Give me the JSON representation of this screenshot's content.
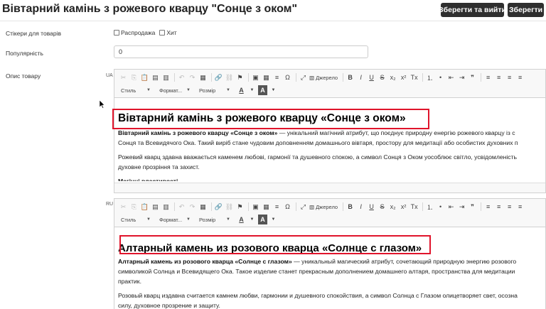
{
  "header": {
    "title": "Вівтарний камінь з рожевого кварцу \"Сонце з оком\"",
    "save_exit_label": "Зберегти та вийти",
    "save_label": "Зберегти"
  },
  "stickers": {
    "label": "Стікери для товарів",
    "options": [
      "Распродажа",
      "Хит"
    ]
  },
  "popularity": {
    "label": "Популярність",
    "value": "0"
  },
  "description": {
    "label": "Опис товару",
    "toolbar": {
      "source_label": "Джерело",
      "style_label": "Стиль",
      "format_label": "Формат...",
      "size_label": "Розмір"
    },
    "editors": [
      {
        "lang": "UA",
        "heading": "Вівтарний камінь з рожевого кварцу «Сонце з оком»",
        "p1_bold": "Вівтарний камінь з рожевого кварцу «Сонце з оком»",
        "p1_rest": " — унікальний магічний атрибут, що поєднує природну енергію рожевого кварцу із с",
        "p1_line2": "Сонця та Всевидячого Ока. Такий виріб стане чудовим доповненням домашнього вівтаря, простору для медитації або особистих духовних п",
        "p2_line1": "Рожевий кварц здавна вважається каменем любові, гармонії та душевного спокою, а символ Сонця з Оком уособлює світло, усвідомленість",
        "p2_line2": "духовне прозріння та захист.",
        "p3_partial": "Магічні властивості"
      },
      {
        "lang": "RU",
        "heading": "Алтарный камень из розового кварца «Солнце с глазом»",
        "p1_bold": "Алтарный камень из розового кварца «Солнце с глазом»",
        "p1_rest": " — уникальный магический атрибут, сочетающий природную энергию розового",
        "p1_line2": "символикой Солнца и Всевидящего Ока. Такое изделие станет прекрасным дополнением домашнего алтаря, пространства для медитации",
        "p1_line3": "практик.",
        "p2_line1": "Розовый кварц издавна считается камнем любви, гармонии и душевного спокойствия, а символ Солнца с Глазом олицетворяет свет, осозна",
        "p2_line2": "силу, духовное прозрение и защиту."
      }
    ]
  },
  "colors": {
    "button_bg": "#2f2f2f",
    "highlight_border": "#e0142b"
  }
}
